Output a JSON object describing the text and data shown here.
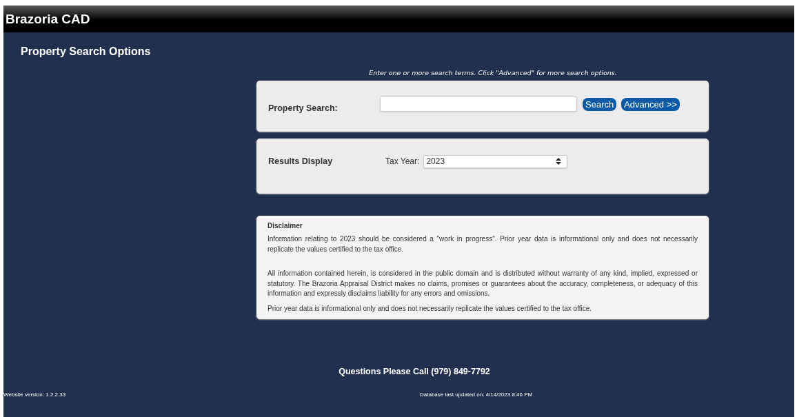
{
  "header": {
    "title": "Brazoria CAD"
  },
  "page_title": "Property Search Options",
  "hint": "Enter one or more search terms. Click \"Advanced\" for more search options.",
  "search": {
    "label": "Property Search:",
    "buttons": [
      "Search",
      "Advanced >>"
    ]
  },
  "results_display": {
    "label": "Results Display",
    "tax_year_label": "Tax Year:",
    "tax_year": "2023"
  },
  "disclaimer": {
    "title": "Disclaimer",
    "paragraphs": [
      "Information relating to 2023 should be considered a \"work in progress\". Prior year data is informational only and does not necessarily replicate the values certified to the tax office.",
      "All information contained herein, is considered in the public domain and is distributed without warranty of any kind, implied, expressed or statutory. The Brazoria Appraisal District makes no claims, promises or guarantees about the accuracy, completeness, or adequacy of this information and expressly disclaims liability for any errors and omissions.",
      "Prior year data is informational only and does not necessarily replicate the values certified to the tax office."
    ]
  },
  "footer": {
    "phone": "Questions Please Call (979) 849-7792",
    "version": "Website version: 1.2.2.33",
    "updated": "Database last updated on: 4/14/2023 8:46 PM"
  }
}
